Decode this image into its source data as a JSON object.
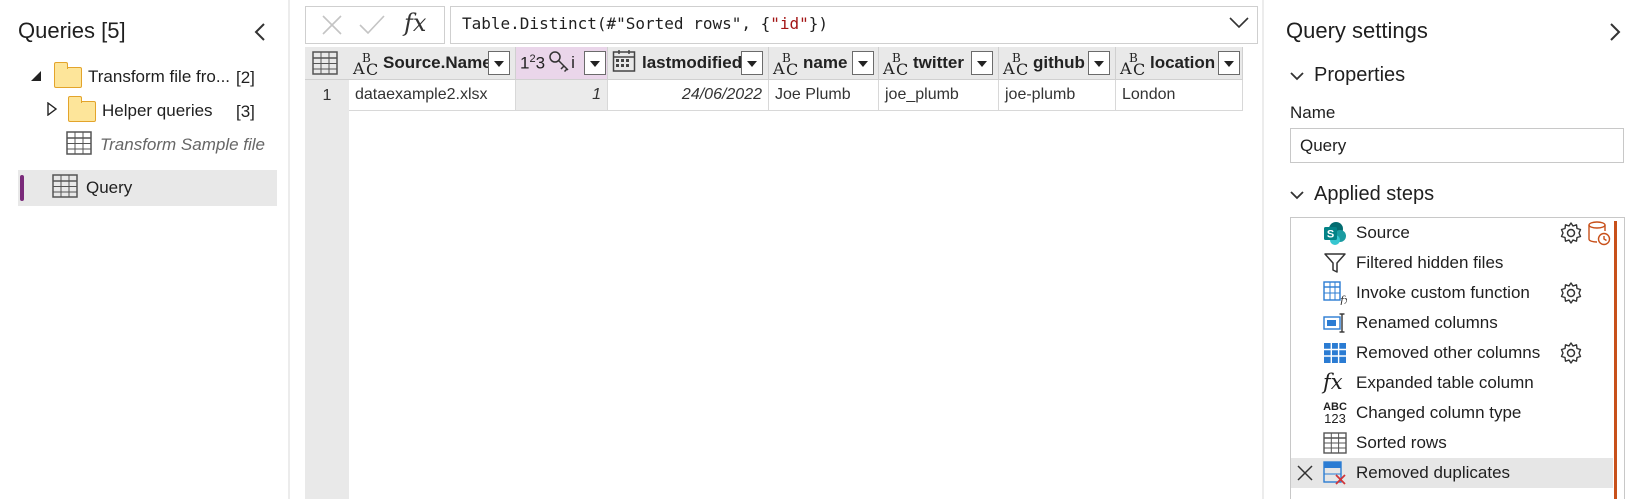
{
  "left_pane": {
    "title": "Queries [5]",
    "items": [
      {
        "label": "Transform file fro...",
        "count": "[2]",
        "kind": "folder",
        "expanded": true
      },
      {
        "label": "Helper queries",
        "count": "[3]",
        "kind": "folder",
        "expanded": false
      },
      {
        "label": "Transform Sample file",
        "kind": "table",
        "italic": true
      },
      {
        "label": "Query",
        "kind": "table",
        "selected": true
      }
    ]
  },
  "formula_bar": {
    "prefix": "Table.Distinct(#\"Sorted rows\", {",
    "string": "\"id\"",
    "suffix": "})",
    "fx_label": "fx"
  },
  "grid": {
    "columns": [
      {
        "type": "ABC",
        "name": "Source.Name"
      },
      {
        "type": "123",
        "name": "i",
        "key": true,
        "selected": true
      },
      {
        "type": "date",
        "name": "lastmodified"
      },
      {
        "type": "ABC",
        "name": "name"
      },
      {
        "type": "ABC",
        "name": "twitter"
      },
      {
        "type": "ABC",
        "name": "github"
      },
      {
        "type": "ABC",
        "name": "location"
      }
    ],
    "rows": [
      {
        "num": "1",
        "cells": [
          "dataexample2.xlsx",
          "1",
          "24/06/2022",
          "Joe Plumb",
          "joe_plumb",
          "joe-plumb",
          "London"
        ]
      }
    ]
  },
  "right_pane": {
    "title": "Query settings",
    "properties_heading": "Properties",
    "name_label": "Name",
    "name_value": "Query",
    "applied_steps_heading": "Applied steps",
    "steps": [
      {
        "label": "Source",
        "icon": "sharepoint-icon",
        "gear": true,
        "warning": true
      },
      {
        "label": "Filtered hidden files",
        "icon": "filter-icon",
        "gear": false
      },
      {
        "label": "Invoke custom function",
        "icon": "table-fx-icon",
        "gear": true
      },
      {
        "label": "Renamed columns",
        "icon": "rename-icon",
        "gear": false
      },
      {
        "label": "Removed other columns",
        "icon": "columns-icon",
        "gear": true
      },
      {
        "label": "Expanded table column",
        "icon": "fx-icon",
        "gear": false
      },
      {
        "label": "Changed column type",
        "icon": "abc123-icon",
        "gear": false
      },
      {
        "label": "Sorted rows",
        "icon": "table-icon",
        "gear": false
      },
      {
        "label": "Removed duplicates",
        "icon": "remove-duplicates-icon",
        "gear": false,
        "active": true
      }
    ],
    "accent_color": "#c8501a"
  },
  "colors": {
    "query_accent": "#7a2a7a",
    "selected_column": "#ead6ea",
    "folder_fill": "#fde59a",
    "folder_border": "#e3a42b"
  }
}
